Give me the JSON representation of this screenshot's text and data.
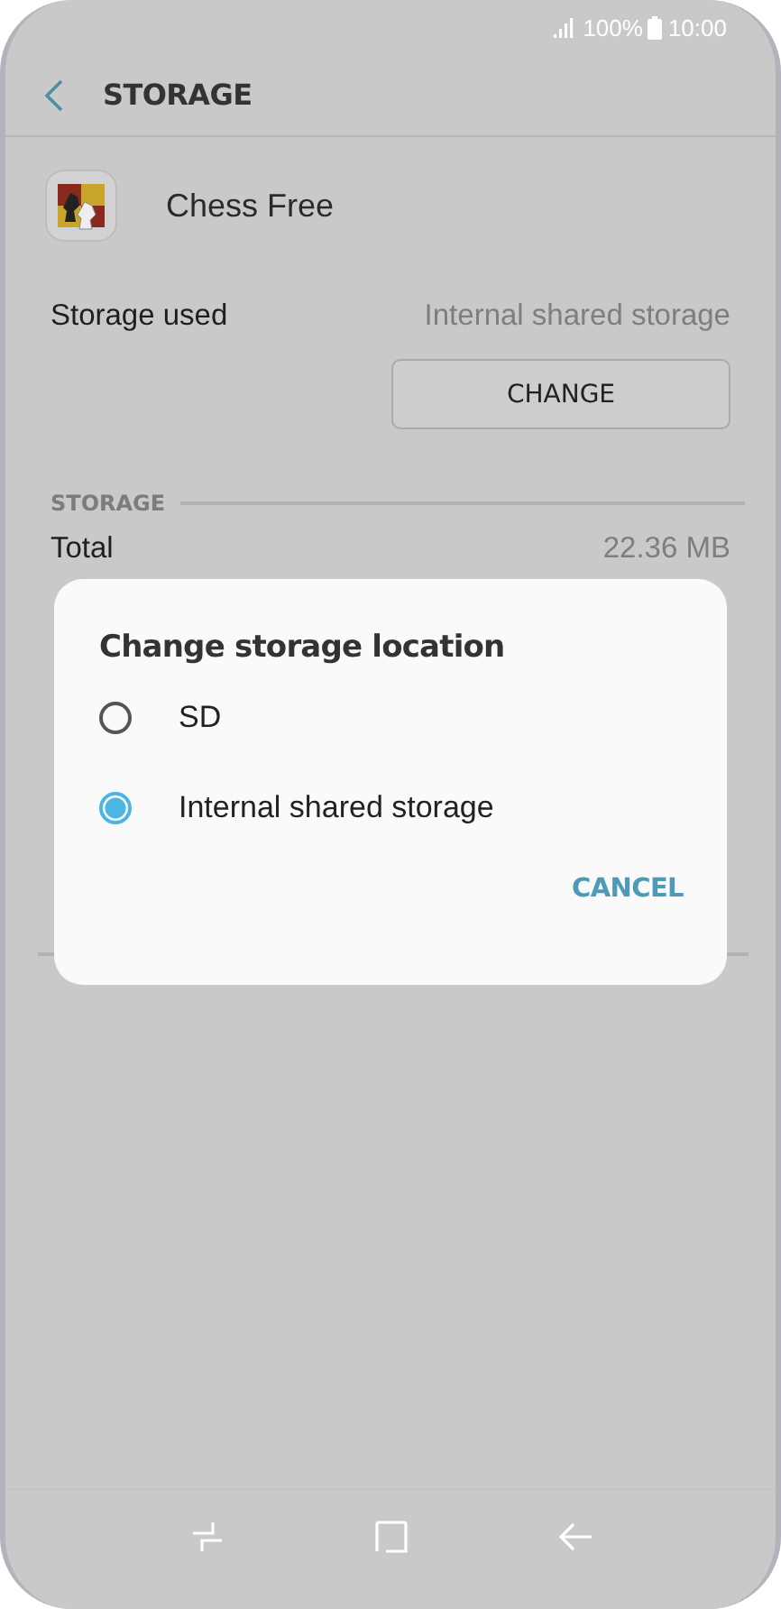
{
  "status_bar": {
    "battery_text": "100%",
    "time": "10:00"
  },
  "header": {
    "title": "STORAGE"
  },
  "app": {
    "name": "Chess Free"
  },
  "storage_used": {
    "label": "Storage used",
    "value": "Internal shared storage",
    "button": "CHANGE"
  },
  "storage_section": {
    "title": "STORAGE",
    "rows": [
      {
        "label": "Total",
        "value": "22.36 MB"
      }
    ]
  },
  "dialog": {
    "title": "Change storage location",
    "options": [
      {
        "label": "SD",
        "selected": false
      },
      {
        "label": "Internal shared storage",
        "selected": true
      }
    ],
    "buttons": [
      "CANCEL"
    ]
  }
}
